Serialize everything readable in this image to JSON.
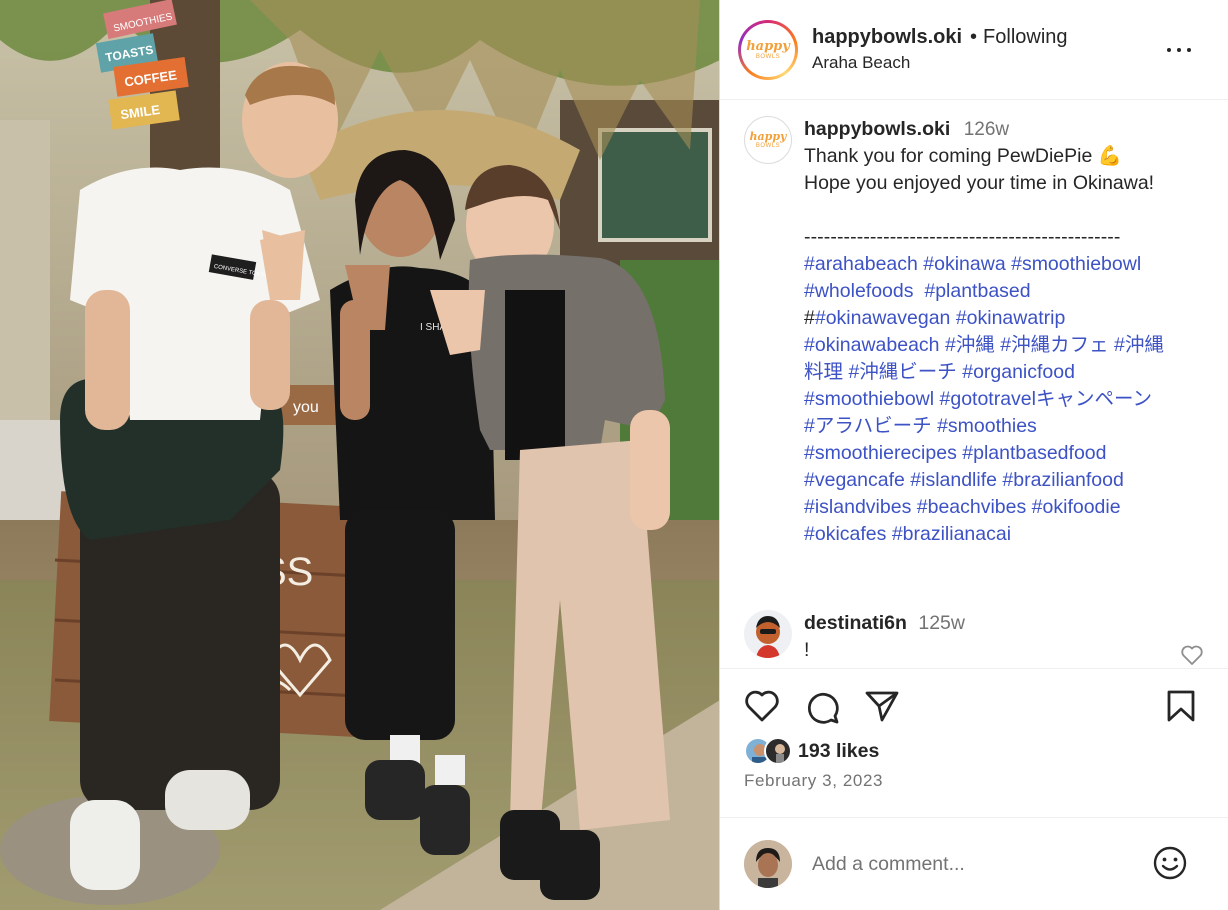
{
  "header": {
    "avatar_text": "happy",
    "avatar_subtext": "BOWLS",
    "username": "happybowls.oki",
    "separator": "•",
    "follow_status": "Following",
    "location": "Araha Beach",
    "more_icon": "more-horizontal-icon"
  },
  "photo": {
    "signs": [
      "SMOOTHIES",
      "TOASTS",
      "COFFEE",
      "SMILE"
    ],
    "shirt_label": "CONVERSE TOKYO",
    "shirt_text": "I SHALL FLOW NOT FALL",
    "crate_text": "you",
    "board_letters": "SS"
  },
  "caption": {
    "username": "happybowls.oki",
    "time": "126w",
    "lines": [
      "Thank you for coming PewDiePie 💪",
      "Hope you enjoyed your time in Okinawa!"
    ],
    "dashes": "------------------------------------------------",
    "hashtag_lines": [
      [
        "#arahabeach",
        "#okinawa",
        "#smoothiebowl"
      ],
      [
        "#wholefoods",
        "#plantbased"
      ],
      [
        "#okinawavegan",
        "#okinawatrip"
      ],
      [
        "#okinawabeach",
        "#沖縄",
        "#沖縄カフェ",
        "#沖縄"
      ],
      [
        "料理",
        "#沖縄ビーチ",
        "#organicfood"
      ],
      [
        "#smoothiebowl",
        "#gototravelキャンペーン"
      ],
      [
        "#アラハビーチ",
        "#smoothies"
      ],
      [
        "#smoothierecipes",
        "#plantbasedfood"
      ],
      [
        "#vegancafe",
        "#islandlife",
        "#brazilianfood"
      ],
      [
        "#islandvibes",
        "#beachvibes",
        "#okifoodie"
      ],
      [
        "#okicafes",
        "#brazilianacai"
      ]
    ],
    "stray_hash": "#"
  },
  "comment": {
    "username": "destinati6n",
    "time": "125w",
    "text": "!",
    "like_icon": "heart-outline-icon"
  },
  "actions": {
    "like_icon": "heart-outline-icon",
    "comment_icon": "comment-bubble-icon",
    "share_icon": "paper-plane-icon",
    "save_icon": "bookmark-icon"
  },
  "likes": {
    "count_label": "193 likes"
  },
  "date": "February 3, 2023",
  "add_comment": {
    "placeholder": "Add a comment...",
    "emoji_icon": "emoji-smile-icon"
  },
  "colors": {
    "hashtag": "#3d52c4",
    "muted": "#737373",
    "text": "#262626",
    "divider": "#efefef"
  }
}
